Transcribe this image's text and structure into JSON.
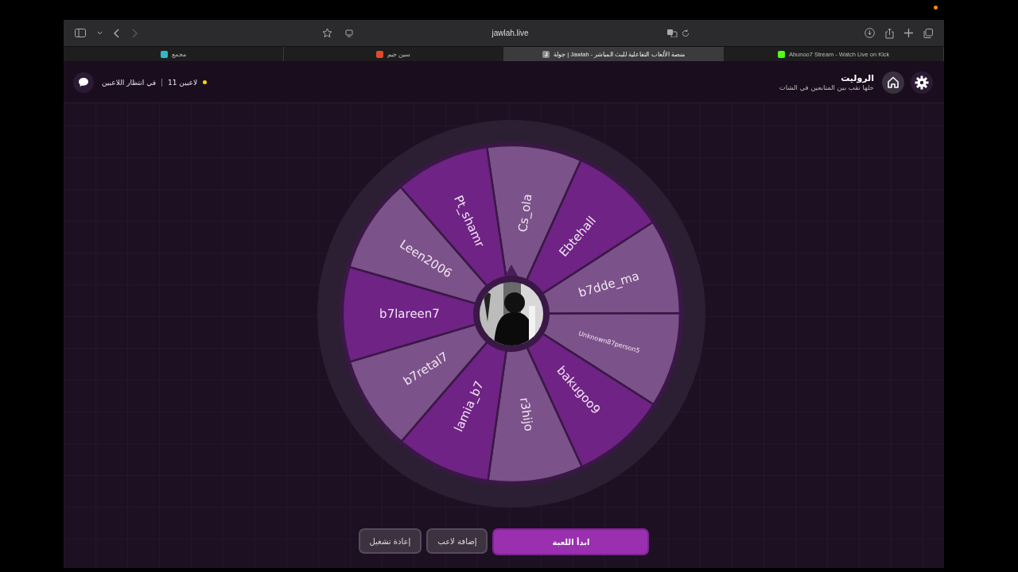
{
  "browser": {
    "url": "jawlah.live",
    "tabs": [
      {
        "label": "Abunoo7 Stream - Watch Live on Kick",
        "selected": false,
        "color": "#53fc18"
      },
      {
        "label": "جولة | Jawlah - منصة الألعاب التفاعلية للبث المباشر",
        "selected": true,
        "color": "#8a8a8a",
        "favicon_letter": "J"
      },
      {
        "label": "سين جيم",
        "selected": false,
        "color": "#e04a2a"
      },
      {
        "label": "مجمع",
        "selected": false,
        "color": "#2fb8c8"
      }
    ]
  },
  "header": {
    "title": "الروليت",
    "subtitle": "خلها تقب بين المتابعين في الشات",
    "status": "في انتظار اللاعبين",
    "player_count": "11 لاعبين"
  },
  "wheel": {
    "segments": [
      {
        "name": "Cs_ola",
        "color": "#7b5289"
      },
      {
        "name": "Ebtehall",
        "color": "#6f2385"
      },
      {
        "name": "b7dde_ma",
        "color": "#7b5289"
      },
      {
        "name": "Unknown87person5",
        "color": "#7b5289"
      },
      {
        "name": "bakugoo9",
        "color": "#6f2385"
      },
      {
        "name": "r3hijo",
        "color": "#7b5289"
      },
      {
        "name": "lamia_b7",
        "color": "#6f2385"
      },
      {
        "name": "b7retal7",
        "color": "#7b5289"
      },
      {
        "name": "b7lareen7",
        "color": "#6f2385"
      },
      {
        "name": "Leen2006",
        "color": "#7b5289"
      },
      {
        "name": "Pt_shamr",
        "color": "#6f2385"
      }
    ]
  },
  "buttons": [
    {
      "label": "ابدأ اللعبة",
      "kind": "primary"
    },
    {
      "label": "إضافة لاعب",
      "kind": "secondary"
    },
    {
      "label": "إعادة تشغيل",
      "kind": "secondary"
    }
  ]
}
